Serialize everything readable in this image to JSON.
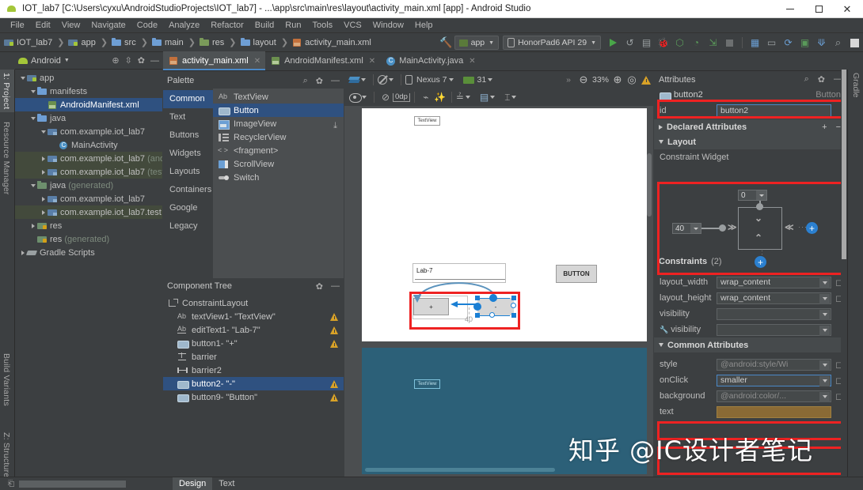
{
  "window": {
    "title": "IOT_lab7 [C:\\Users\\cyxu\\AndroidStudioProjects\\IOT_lab7] - ...\\app\\src\\main\\res\\layout\\activity_main.xml [app] - Android Studio",
    "app_icon": "android-icon",
    "minimize_label": "—",
    "maximize_label": "□",
    "close_label": "✕"
  },
  "menubar": {
    "items": [
      "File",
      "Edit",
      "View",
      "Navigate",
      "Code",
      "Analyze",
      "Refactor",
      "Build",
      "Run",
      "Tools",
      "VCS",
      "Window",
      "Help"
    ]
  },
  "breadcrumb": {
    "items": [
      {
        "label": "IOT_lab7",
        "icon": "module-icon"
      },
      {
        "label": "app",
        "icon": "module-icon"
      },
      {
        "label": "src",
        "icon": "folder-icon"
      },
      {
        "label": "main",
        "icon": "folder-icon"
      },
      {
        "label": "res",
        "icon": "res-folder-icon"
      },
      {
        "label": "layout",
        "icon": "folder-icon"
      },
      {
        "label": "activity_main.xml",
        "icon": "xml-file-icon"
      }
    ],
    "separator": "❯"
  },
  "main_toolbar": {
    "run_config": "app",
    "device": "HonorPad6 API 29",
    "icons": [
      "hammer-icon",
      "run-icon",
      "apply-changes-icon",
      "apply-code-changes-icon",
      "debug-icon",
      "attach-debugger-icon",
      "profiler-icon",
      "device-file-explorer-icon",
      "stop-icon",
      "sdk-manager-icon",
      "avd-manager-icon",
      "sync-gradle-icon",
      "avd-icon",
      "update-icon",
      "search-icon",
      "layout-icon"
    ]
  },
  "left_tool_tabs": [
    {
      "label": "1: Project",
      "selected": true
    },
    {
      "label": "Resource Manager",
      "selected": false
    },
    {
      "label": "Build Variants",
      "selected": false
    },
    {
      "label": "Z: Structure",
      "selected": false
    }
  ],
  "right_tool_tabs": [
    {
      "label": "Gradle"
    }
  ],
  "project_panel": {
    "title": "Android",
    "header_icons": [
      "target-icon",
      "collapse-icon",
      "gear-icon",
      "hide-icon"
    ],
    "tree": [
      {
        "depth": 0,
        "label": "app",
        "icon": "module-icon",
        "arrow": "open",
        "selected": false,
        "highlight": false
      },
      {
        "depth": 1,
        "label": "manifests",
        "icon": "folder-icon",
        "arrow": "open",
        "selected": false,
        "highlight": false
      },
      {
        "depth": 2,
        "label": "AndroidManifest.xml",
        "icon": "manifest-icon",
        "arrow": "none",
        "selected": true,
        "highlight": false
      },
      {
        "depth": 1,
        "label": "java",
        "icon": "folder-icon",
        "arrow": "open",
        "selected": false,
        "highlight": false
      },
      {
        "depth": 2,
        "label": "com.example.iot_lab7",
        "icon": "package-icon",
        "arrow": "open",
        "selected": false,
        "highlight": false
      },
      {
        "depth": 3,
        "label": "MainActivity",
        "icon": "class-icon",
        "arrow": "none",
        "selected": false,
        "highlight": false
      },
      {
        "depth": 2,
        "label": "com.example.iot_lab7",
        "suffix": "(androidTest)",
        "icon": "package-icon",
        "arrow": "closed",
        "selected": false,
        "highlight": true
      },
      {
        "depth": 2,
        "label": "com.example.iot_lab7",
        "suffix": "(test)",
        "icon": "package-icon",
        "arrow": "closed",
        "selected": false,
        "highlight": true
      },
      {
        "depth": 1,
        "label": "java",
        "suffix": "(generated)",
        "icon": "gen-folder-icon",
        "arrow": "open",
        "selected": false,
        "highlight": false
      },
      {
        "depth": 2,
        "label": "com.example.iot_lab7",
        "icon": "package-icon",
        "arrow": "closed",
        "selected": false,
        "highlight": false
      },
      {
        "depth": 2,
        "label": "com.example.iot_lab7.test",
        "icon": "package-icon",
        "arrow": "closed",
        "selected": false,
        "highlight": true
      },
      {
        "depth": 1,
        "label": "res",
        "icon": "res-folder-icon",
        "arrow": "closed",
        "selected": false,
        "highlight": false
      },
      {
        "depth": 1,
        "label": "res",
        "suffix": "(generated)",
        "icon": "res-folder-icon",
        "arrow": "none",
        "selected": false,
        "highlight": false
      },
      {
        "depth": 0,
        "label": "Gradle Scripts",
        "icon": "gradle-icon",
        "arrow": "closed",
        "selected": false,
        "highlight": false
      }
    ]
  },
  "editor_tabs": [
    {
      "label": "activity_main.xml",
      "icon": "xml-file-icon",
      "active": true
    },
    {
      "label": "AndroidManifest.xml",
      "icon": "manifest-icon",
      "active": false
    },
    {
      "label": "MainActivity.java",
      "icon": "class-icon",
      "active": false
    }
  ],
  "palette": {
    "title": "Palette",
    "header_icons": [
      "search-icon",
      "gear-icon",
      "hide-icon"
    ],
    "categories": [
      {
        "label": "Common",
        "selected": true
      },
      {
        "label": "Text",
        "selected": false
      },
      {
        "label": "Buttons",
        "selected": false
      },
      {
        "label": "Widgets",
        "selected": false
      },
      {
        "label": "Layouts",
        "selected": false
      },
      {
        "label": "Containers",
        "selected": false
      },
      {
        "label": "Google",
        "selected": false
      },
      {
        "label": "Legacy",
        "selected": false
      }
    ],
    "items": [
      {
        "label": "TextView",
        "icon": "textview-icon",
        "selected": false
      },
      {
        "label": "Button",
        "icon": "button-icon",
        "selected": true
      },
      {
        "label": "ImageView",
        "icon": "imageview-icon",
        "selected": false
      },
      {
        "label": "RecyclerView",
        "icon": "recyclerview-icon",
        "selected": false,
        "download": true
      },
      {
        "label": "<fragment>",
        "icon": "fragment-icon",
        "selected": false
      },
      {
        "label": "ScrollView",
        "icon": "scrollview-icon",
        "selected": false
      },
      {
        "label": "Switch",
        "icon": "switch-icon",
        "selected": false
      }
    ]
  },
  "component_tree": {
    "title": "Component Tree",
    "header_icons": [
      "gear-icon",
      "hide-icon"
    ],
    "rows": [
      {
        "depth": 0,
        "label": "ConstraintLayout",
        "icon": "constraintlayout-icon",
        "warning": false,
        "selected": false
      },
      {
        "depth": 1,
        "label": "textView1- \"TextView\"",
        "icon": "textview-icon",
        "warning": true,
        "selected": false
      },
      {
        "depth": 1,
        "label": "editText1- \"Lab-7\"",
        "icon": "edittext-icon",
        "warning": true,
        "selected": false
      },
      {
        "depth": 1,
        "label": "button1- \"+\"",
        "icon": "button-icon",
        "warning": true,
        "selected": false
      },
      {
        "depth": 1,
        "label": "barrier",
        "icon": "barrier-vertical-icon",
        "warning": false,
        "selected": false
      },
      {
        "depth": 1,
        "label": "barrier2",
        "icon": "barrier-horizontal-icon",
        "warning": false,
        "selected": false
      },
      {
        "depth": 1,
        "label": "button2- \"-\"",
        "icon": "button-icon",
        "warning": true,
        "selected": true
      },
      {
        "depth": 1,
        "label": "button9- \"Button\"",
        "icon": "button-icon",
        "warning": true,
        "selected": false
      }
    ]
  },
  "design_toolbar": {
    "row1": {
      "design_mode_icon": "layers-icon",
      "orientation_icon": "rotate-icon",
      "device": "Nexus 7",
      "api_level": "31",
      "overflow": "»",
      "zoom_out": "−",
      "zoom_level": "33%",
      "zoom_in": "+",
      "zoom_fit": "◎",
      "warning_icon": "warning-icon"
    },
    "row2": {
      "eye_icon": "eye-icon",
      "no_constraints_icon": "clear-constraints-icon",
      "margin_value": "0dp",
      "autoconnect_icon": "autoconnect-icon",
      "infer_icon": "magic-wand-icon",
      "guidelines_icon": "guidelines-icon",
      "align_icon": "align-icon",
      "baseline_icon": "baseline-icon"
    }
  },
  "canvas": {
    "textview_label": "TextView",
    "edittext_value": "Lab-7",
    "button_big_label": "BUTTON",
    "button_plus_label": "+",
    "button_minus_label": "-",
    "margin_label": "40",
    "blueprint_textview_label": "TextView"
  },
  "attributes": {
    "title": "Attributes",
    "header_icons": [
      "search-icon",
      "gear-icon",
      "hide-icon"
    ],
    "subject_name": "button2",
    "subject_type": "Button",
    "id_label": "id",
    "id_value": "button2",
    "declared_section": "Declared Attributes",
    "declared_add": "+",
    "declared_remove": "−",
    "layout_section": "Layout",
    "constraint_widget_label": "Constraint Widget",
    "constraint_top_value": "0",
    "constraint_left_value": "40",
    "constraints_section": "Constraints",
    "constraints_count": "(2)",
    "common_section": "Common Attributes",
    "rows": [
      {
        "label": "layout_width",
        "value": "wrap_content",
        "dim": false,
        "dropdown": true,
        "pin": "◻"
      },
      {
        "label": "layout_height",
        "value": "wrap_content",
        "dim": false,
        "dropdown": true,
        "pin": "◻"
      },
      {
        "label": "visibility",
        "value": "",
        "dim": false,
        "dropdown": true,
        "pin": ""
      },
      {
        "label": "visibility",
        "value": "",
        "dim": false,
        "dropdown": true,
        "pin": "",
        "wrench": true
      }
    ],
    "common_rows": [
      {
        "label": "style",
        "value": "@android:style/Wi",
        "dim": true,
        "dropdown": true,
        "pin": "◻"
      },
      {
        "label": "onClick",
        "value": "smaller",
        "dim": false,
        "dropdown": true,
        "pin": "◻",
        "focused": true
      },
      {
        "label": "background",
        "value": "@android:color/...",
        "dim": true,
        "dropdown": true,
        "pin": "◻"
      },
      {
        "label": "text",
        "value": "",
        "dim": false,
        "dropdown": false,
        "pin": ""
      }
    ]
  },
  "bottom_bar": {
    "tabs": [
      {
        "label": "Design",
        "selected": true
      },
      {
        "label": "Text",
        "selected": false
      }
    ]
  },
  "watermark": {
    "text": "知乎 @IC设计者笔记"
  },
  "colors": {
    "panel_bg": "#3c3f41",
    "selection_blue": "#2f5180",
    "accent_blue": "#4a88c7",
    "highlight_red": "#ee2222",
    "blueprint_teal": "#2c6078",
    "warning_amber": "#d9a227"
  }
}
